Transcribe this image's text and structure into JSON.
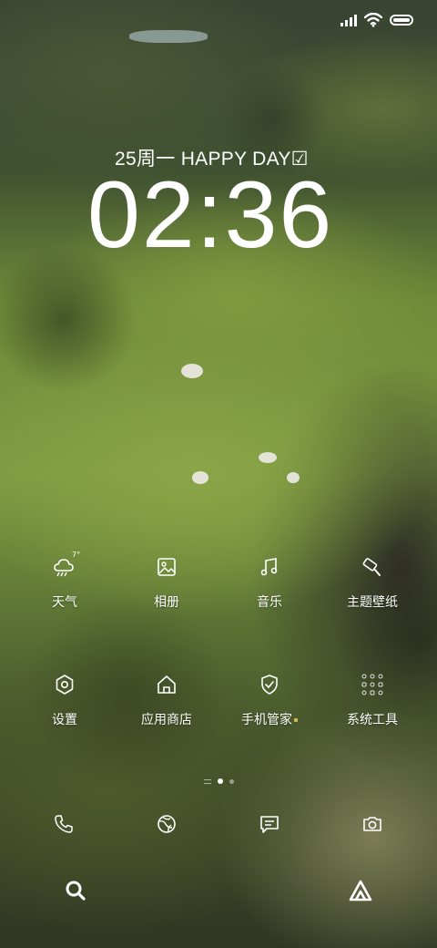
{
  "status_bar": {
    "signal_icon": "signal-icon",
    "wifi_icon": "wifi-icon",
    "battery_icon": "battery-icon",
    "battery_level": 1.0
  },
  "clock": {
    "date": "25周一  HAPPY DAY☑",
    "time": "02:36"
  },
  "apps": [
    {
      "label": "天气",
      "icon": "weather-icon",
      "badge": "7°"
    },
    {
      "label": "相册",
      "icon": "gallery-icon"
    },
    {
      "label": "音乐",
      "icon": "music-icon"
    },
    {
      "label": "主题壁纸",
      "icon": "themes-icon"
    },
    {
      "label": "设置",
      "icon": "settings-icon"
    },
    {
      "label": "应用商店",
      "icon": "app-store-icon"
    },
    {
      "label": "手机管家",
      "icon": "security-icon"
    },
    {
      "label": "系统工具",
      "icon": "system-tools-folder-icon"
    }
  ],
  "pager": {
    "pages": 2,
    "current": 1
  },
  "dock": [
    {
      "icon": "phone-icon"
    },
    {
      "icon": "browser-icon"
    },
    {
      "icon": "messages-icon"
    },
    {
      "icon": "camera-icon"
    }
  ],
  "bottom": [
    {
      "icon": "search-icon"
    },
    {
      "icon": "assistant-icon"
    }
  ]
}
